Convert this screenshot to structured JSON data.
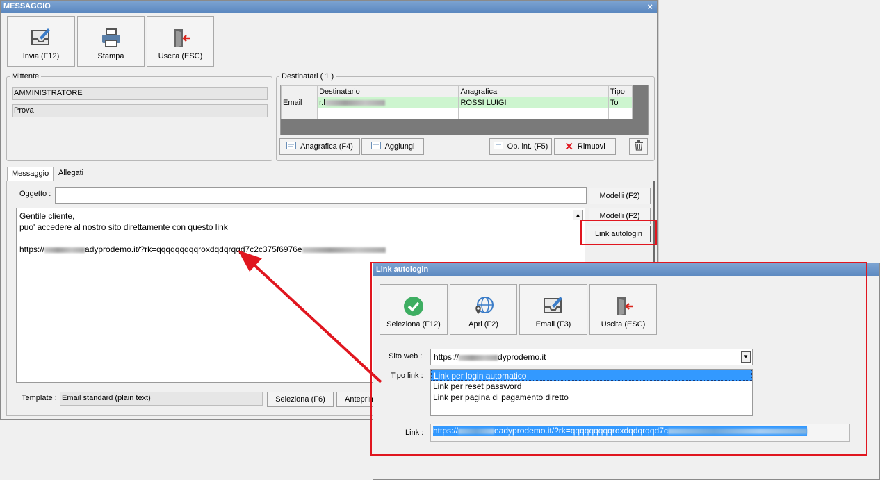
{
  "main": {
    "title": "MESSAGGIO",
    "close_icon": "×",
    "toolbar": [
      {
        "label": "Invia (F12)",
        "icon": "send-mail-icon"
      },
      {
        "label": "Stampa",
        "icon": "printer-icon"
      },
      {
        "label": "Uscita (ESC)",
        "icon": "exit-door-icon"
      }
    ],
    "sender": {
      "title": "Mittente",
      "name": "AMMINISTRATORE",
      "detail": "Prova"
    },
    "recipients": {
      "title": "Destinatari ( 1 )",
      "columns": [
        "Destinatario",
        "Anagrafica",
        "Tipo"
      ],
      "rows": [
        {
          "type": "Email",
          "recipient_prefix": "r.l",
          "anagrafica": "ROSSI LUIGI",
          "tipo": "To"
        }
      ],
      "buttons": {
        "anagrafica": "Anagrafica (F4)",
        "aggiungi": "Aggiungi",
        "op_int": "Op. int. (F5)",
        "rimuovi": "Rimuovi"
      }
    },
    "tabs": [
      "Messaggio",
      "Allegati"
    ],
    "subject_label": "Oggetto :",
    "subject_value": "",
    "models_button_1": "Modelli (F2)",
    "models_button_2": "Modelli (F2)",
    "link_autologin_button": "Link autologin",
    "body": {
      "line1": "Gentile cliente,",
      "line2": "puo' accedere al nostro sito direttamente con questo link",
      "link_prefix": "https://",
      "link_mid": "adyprodemo.it/?rk=qqqqqqqqqroxdqdqrqqd7c2c375f6976e"
    },
    "template_label": "Template :",
    "template_value": "Email standard (plain text)",
    "seleziona_button": "Seleziona (F6)",
    "anteprima_button": "Anteprim"
  },
  "dialog": {
    "title": "Link autologin",
    "toolbar": [
      {
        "label": "Seleziona (F12)",
        "icon": "check-circle-icon"
      },
      {
        "label": "Apri (F2)",
        "icon": "globe-pin-icon"
      },
      {
        "label": "Email (F3)",
        "icon": "send-mail-icon"
      },
      {
        "label": "Uscita (ESC)",
        "icon": "exit-door-icon"
      }
    ],
    "site_label": "Sito web :",
    "site_prefix": "https://",
    "site_suffix": "dyprodemo.it",
    "type_label": "Tipo link :",
    "link_types": [
      "Link per login automatico",
      "Link per reset password",
      "Link per pagina di pagamento diretto"
    ],
    "selected_type": "Link per login automatico",
    "link_label": "Link :",
    "link_prefix": "https://",
    "link_mid": "eadyprodemo.it/?rk=qqqqqqqqqroxdqdqrqqd7c"
  },
  "colors": {
    "highlight": "#e0161f",
    "selection": "#3399ff",
    "row_green": "#cdf5cf"
  }
}
